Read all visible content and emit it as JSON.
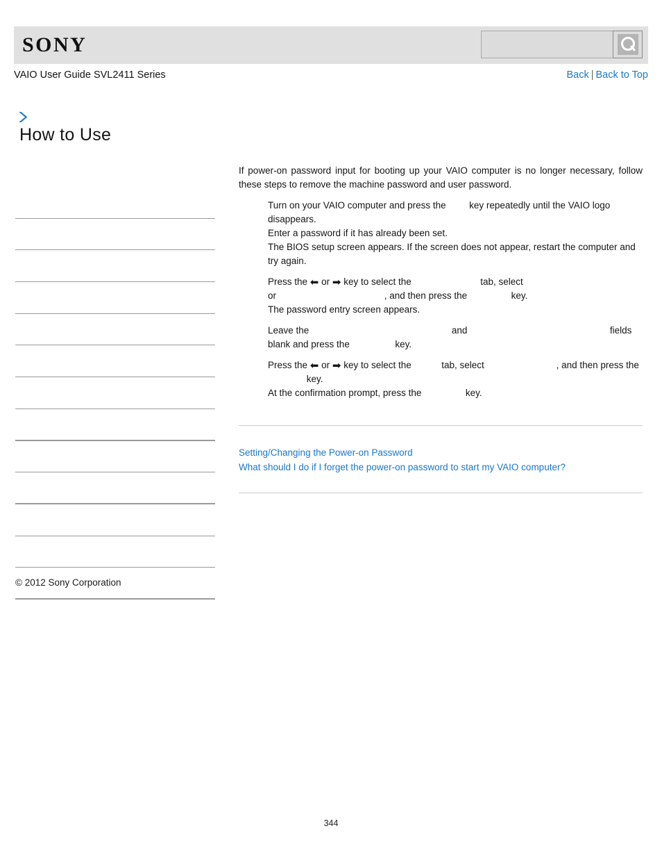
{
  "header": {
    "logo_text": "SONY",
    "search": {
      "value": "",
      "placeholder": "",
      "icon": "search-icon",
      "button_label": ""
    }
  },
  "sub_header": {
    "guide_title": "VAIO User Guide SVL2411 Series",
    "back_label": "Back",
    "separator": "|",
    "back_to_top_label": "Back to Top"
  },
  "sidebar": {
    "chevron_icon": "chevron-right-icon",
    "heading": "How to Use",
    "items": [
      {
        "label": ""
      },
      {
        "label": ""
      },
      {
        "label": ""
      },
      {
        "label": ""
      },
      {
        "label": ""
      },
      {
        "label": ""
      },
      {
        "label": ""
      },
      {
        "label": ""
      },
      {
        "label": ""
      },
      {
        "label": ""
      },
      {
        "label": ""
      },
      {
        "label": ""
      },
      {
        "label": ""
      }
    ],
    "copyright": "© 2012 Sony Corporation"
  },
  "content": {
    "intro": "If power-on password input for booting up your VAIO computer is no longer necessary, follow these steps to remove the machine password and user password.",
    "steps": [
      {
        "lines": [
          {
            "segments": [
              {
                "text": "Turn on your VAIO computer and press the "
              },
              {
                "text": "",
                "blank_width": 26
              },
              {
                "text": " key repeatedly until the VAIO logo disappears."
              }
            ]
          },
          {
            "segments": [
              {
                "text": "Enter a password if it has already been set."
              }
            ]
          },
          {
            "segments": [
              {
                "text": "The BIOS setup screen appears. If the screen does not appear, restart the computer and try again."
              }
            ]
          }
        ]
      },
      {
        "lines": [
          {
            "segments": [
              {
                "text": "Press the "
              },
              {
                "text": "⬅",
                "arrow": true
              },
              {
                "text": " or "
              },
              {
                "text": "➡",
                "arrow": true
              },
              {
                "text": " key to select the "
              },
              {
                "text": "",
                "blank_width": 92
              },
              {
                "text": " tab, select "
              },
              {
                "text": "",
                "blank_width": 160
              },
              {
                "text": " or "
              },
              {
                "text": "",
                "blank_width": 152
              },
              {
                "text": ", and then press the "
              },
              {
                "text": "",
                "blank_width": 56
              },
              {
                "text": " key."
              }
            ]
          },
          {
            "segments": [
              {
                "text": "The password entry screen appears."
              }
            ]
          }
        ]
      },
      {
        "lines": [
          {
            "segments": [
              {
                "text": "Leave the "
              },
              {
                "text": "",
                "blank_width": 198
              },
              {
                "text": " and "
              },
              {
                "text": "",
                "blank_width": 198
              },
              {
                "text": " fields blank and press the "
              },
              {
                "text": "",
                "blank_width": 58
              },
              {
                "text": " key."
              }
            ]
          }
        ]
      },
      {
        "lines": [
          {
            "segments": [
              {
                "text": "Press the "
              },
              {
                "text": "⬅",
                "arrow": true
              },
              {
                "text": " or "
              },
              {
                "text": "➡",
                "arrow": true
              },
              {
                "text": " key to select the "
              },
              {
                "text": "",
                "blank_width": 36
              },
              {
                "text": " tab, select "
              },
              {
                "text": "",
                "blank_width": 100
              },
              {
                "text": ", and then press the "
              },
              {
                "text": "",
                "blank_width": 52
              },
              {
                "text": " key."
              }
            ]
          },
          {
            "segments": [
              {
                "text": "At the confirmation prompt, press the "
              },
              {
                "text": "",
                "blank_width": 56
              },
              {
                "text": " key."
              }
            ]
          }
        ]
      }
    ],
    "related_links": [
      "Setting/Changing the Power-on Password",
      "What should I do if I forget the power-on password to start my VAIO computer?"
    ]
  },
  "footer": {
    "page_number": "344"
  },
  "colors": {
    "link": "#1878c8",
    "header_bg": "#e0e0e0",
    "divider": "#9a9a9a",
    "content_divider": "#cccccc",
    "accent_chevron": "#2a7fc1"
  }
}
